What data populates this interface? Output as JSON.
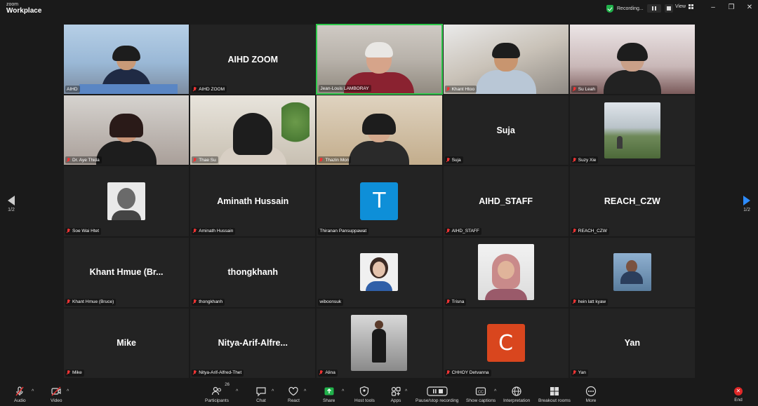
{
  "window": {
    "brand_top": "zoom",
    "brand_bottom": "Workplace",
    "recording_label": "Recording...",
    "view_label": "View",
    "minimize": "–",
    "restore": "❐",
    "close": "✕"
  },
  "pagination": {
    "left": "1/2",
    "right": "1/2"
  },
  "tiles": [
    {
      "id": "aihd",
      "label": "AIHD",
      "muted": false,
      "type": "video"
    },
    {
      "id": "aihd-zoom",
      "label": "AIHD ZOOM",
      "big_name": "AIHD ZOOM",
      "muted": true,
      "type": "name"
    },
    {
      "id": "jean-louis",
      "label": "Jean-Louis LAMBORAY",
      "muted": false,
      "type": "video",
      "speaker": true
    },
    {
      "id": "khant-htoo",
      "label": "Khant Htoo",
      "muted": true,
      "type": "video"
    },
    {
      "id": "su-leah",
      "label": "Su Leah",
      "muted": true,
      "type": "video"
    },
    {
      "id": "aye-thida",
      "label": "Dr. Aye Thida",
      "muted": true,
      "type": "video"
    },
    {
      "id": "thae-su",
      "label": "Thae Su",
      "muted": true,
      "type": "video"
    },
    {
      "id": "thazin-mon",
      "label": "Thazin Mon",
      "muted": true,
      "type": "video"
    },
    {
      "id": "suja",
      "label": "Suja",
      "big_name": "Suja",
      "muted": true,
      "type": "name"
    },
    {
      "id": "suzy-xie",
      "label": "Suzy Xie",
      "muted": true,
      "type": "photo"
    },
    {
      "id": "soe-wai-htet",
      "label": "Soe Wai Htet",
      "muted": true,
      "type": "photo"
    },
    {
      "id": "aminath",
      "label": "Aminath Hussain",
      "big_name": "Aminath Hussain",
      "muted": true,
      "type": "name"
    },
    {
      "id": "thiranan",
      "label": "Thiranan Pansuppawat",
      "avatar_letter": "T",
      "avatar_color": "#0e8fd8",
      "muted": false,
      "type": "letter"
    },
    {
      "id": "aihd-staff",
      "label": "AIHD_STAFF",
      "big_name": "AIHD_STAFF",
      "muted": true,
      "type": "name"
    },
    {
      "id": "reach-czw",
      "label": "REACH_CZW",
      "big_name": "REACH_CZW",
      "muted": true,
      "type": "name"
    },
    {
      "id": "khant-hmue",
      "label": "Khant Hmue (Bruce)",
      "big_name": "Khant Hmue (Br...",
      "muted": true,
      "type": "name"
    },
    {
      "id": "thongkhanh",
      "label": "thongkhanh",
      "big_name": "thongkhanh",
      "muted": true,
      "type": "name"
    },
    {
      "id": "wiboonsuk",
      "label": "wiboonsuk",
      "muted": false,
      "type": "photo"
    },
    {
      "id": "trisna",
      "label": "Trisna",
      "muted": true,
      "type": "photo"
    },
    {
      "id": "hein-latt",
      "label": "hein latt kyaw",
      "muted": true,
      "type": "photo"
    },
    {
      "id": "mike",
      "label": "Mike",
      "big_name": "Mike",
      "muted": true,
      "type": "name"
    },
    {
      "id": "nitya",
      "label": "Nitya-Arif-Alfred-Thet",
      "big_name": "Nitya-Arif-Alfre...",
      "muted": true,
      "type": "name"
    },
    {
      "id": "alina",
      "label": "Alina",
      "muted": true,
      "type": "photo"
    },
    {
      "id": "chhoy",
      "label": "CHHOY Detvanna",
      "avatar_letter": "C",
      "avatar_color": "#d9461e",
      "muted": true,
      "type": "letter"
    },
    {
      "id": "yan",
      "label": "Yan",
      "big_name": "Yan",
      "muted": true,
      "type": "name"
    }
  ],
  "toolbar": {
    "audio": "Audio",
    "video": "Video",
    "participants": "Participants",
    "participants_count": "26",
    "chat": "Chat",
    "react": "React",
    "share": "Share",
    "host_tools": "Host tools",
    "apps": "Apps",
    "pause_recording": "Pause/stop recording",
    "show_captions": "Show captions",
    "interpretation": "Interpretation",
    "breakout_rooms": "Breakout rooms",
    "more": "More",
    "end": "End",
    "accent_share": "#21b24b",
    "accent_end": "#e02828"
  }
}
